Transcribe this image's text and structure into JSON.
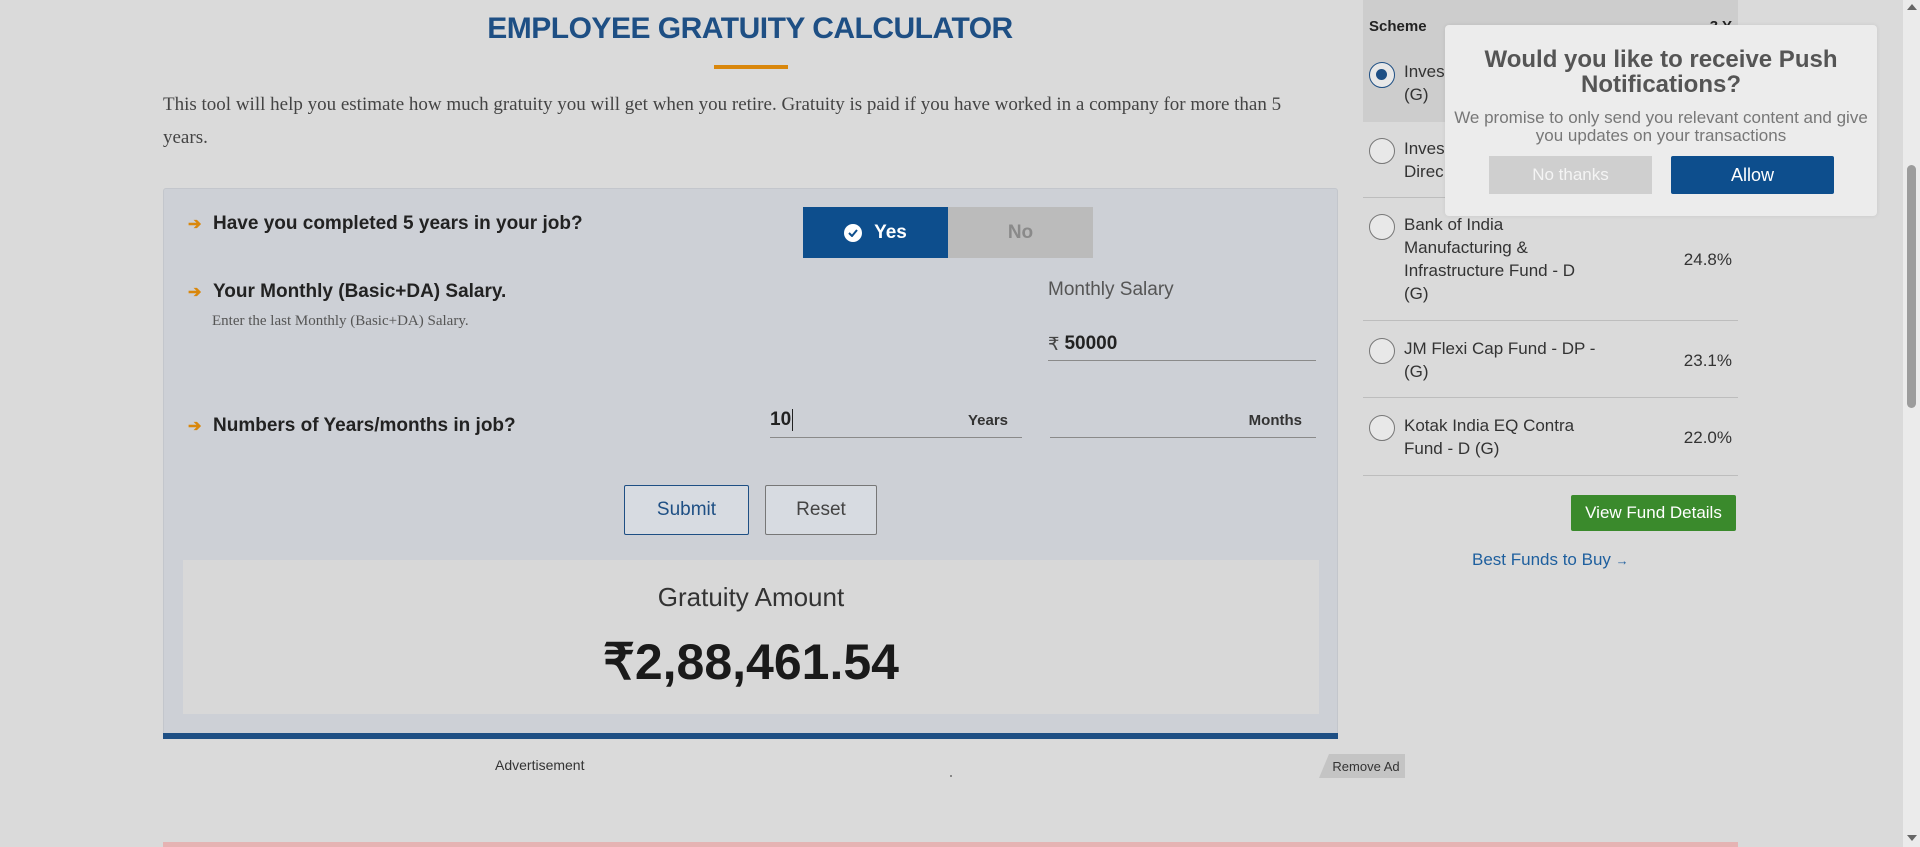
{
  "page": {
    "title": "EMPLOYEE GRATUITY CALCULATOR",
    "intro": "This tool will help you estimate how much gratuity you will get when you retire. Gratuity is paid if you have worked in a company for more than 5 years."
  },
  "calculator": {
    "q1": {
      "text": "Have you completed 5 years in your job?",
      "yes_label": "Yes",
      "no_label": "No",
      "selected": "Yes"
    },
    "q2": {
      "text": "Your Monthly (Basic+DA) Salary.",
      "sub": "Enter the last Monthly (Basic+DA) Salary.",
      "field_label": "Monthly Salary",
      "currency": "₹",
      "value": "50000"
    },
    "q3": {
      "text": "Numbers of Years/months in job?",
      "years_value": "10",
      "years_unit": "Years",
      "months_value": "",
      "months_unit": "Months"
    },
    "submit_label": "Submit",
    "reset_label": "Reset",
    "result": {
      "label": "Gratuity Amount",
      "value": "₹2,88,461.54"
    }
  },
  "ad": {
    "label": "Advertisement",
    "remove_label": "Remove Ad"
  },
  "sidebar": {
    "header": {
      "scheme": "Scheme",
      "returns": "3 Y"
    },
    "funds": [
      {
        "name": "Inves\n(G)",
        "return": "",
        "selected": true
      },
      {
        "name": "Inves\nDirec",
        "return": "",
        "selected": false
      },
      {
        "name": "Bank of India Manufacturing & Infrastructure Fund - D (G)",
        "return": "24.8%",
        "selected": false
      },
      {
        "name": "JM Flexi Cap Fund - DP - (G)",
        "return": "23.1%",
        "selected": false
      },
      {
        "name": "Kotak India EQ Contra Fund - D (G)",
        "return": "22.0%",
        "selected": false
      }
    ],
    "view_button": "View Fund Details",
    "best_funds_link": "Best Funds to Buy",
    "best_funds_arrow": "→"
  },
  "popup": {
    "title": "Would you like to receive Push Notifications?",
    "text": "We promise to only send you relevant content and give you updates on your transactions",
    "no_label": "No thanks",
    "allow_label": "Allow"
  },
  "colors": {
    "brand_blue": "#1e4f84",
    "accent_orange": "#d9870c",
    "green": "#3a8a2c"
  }
}
